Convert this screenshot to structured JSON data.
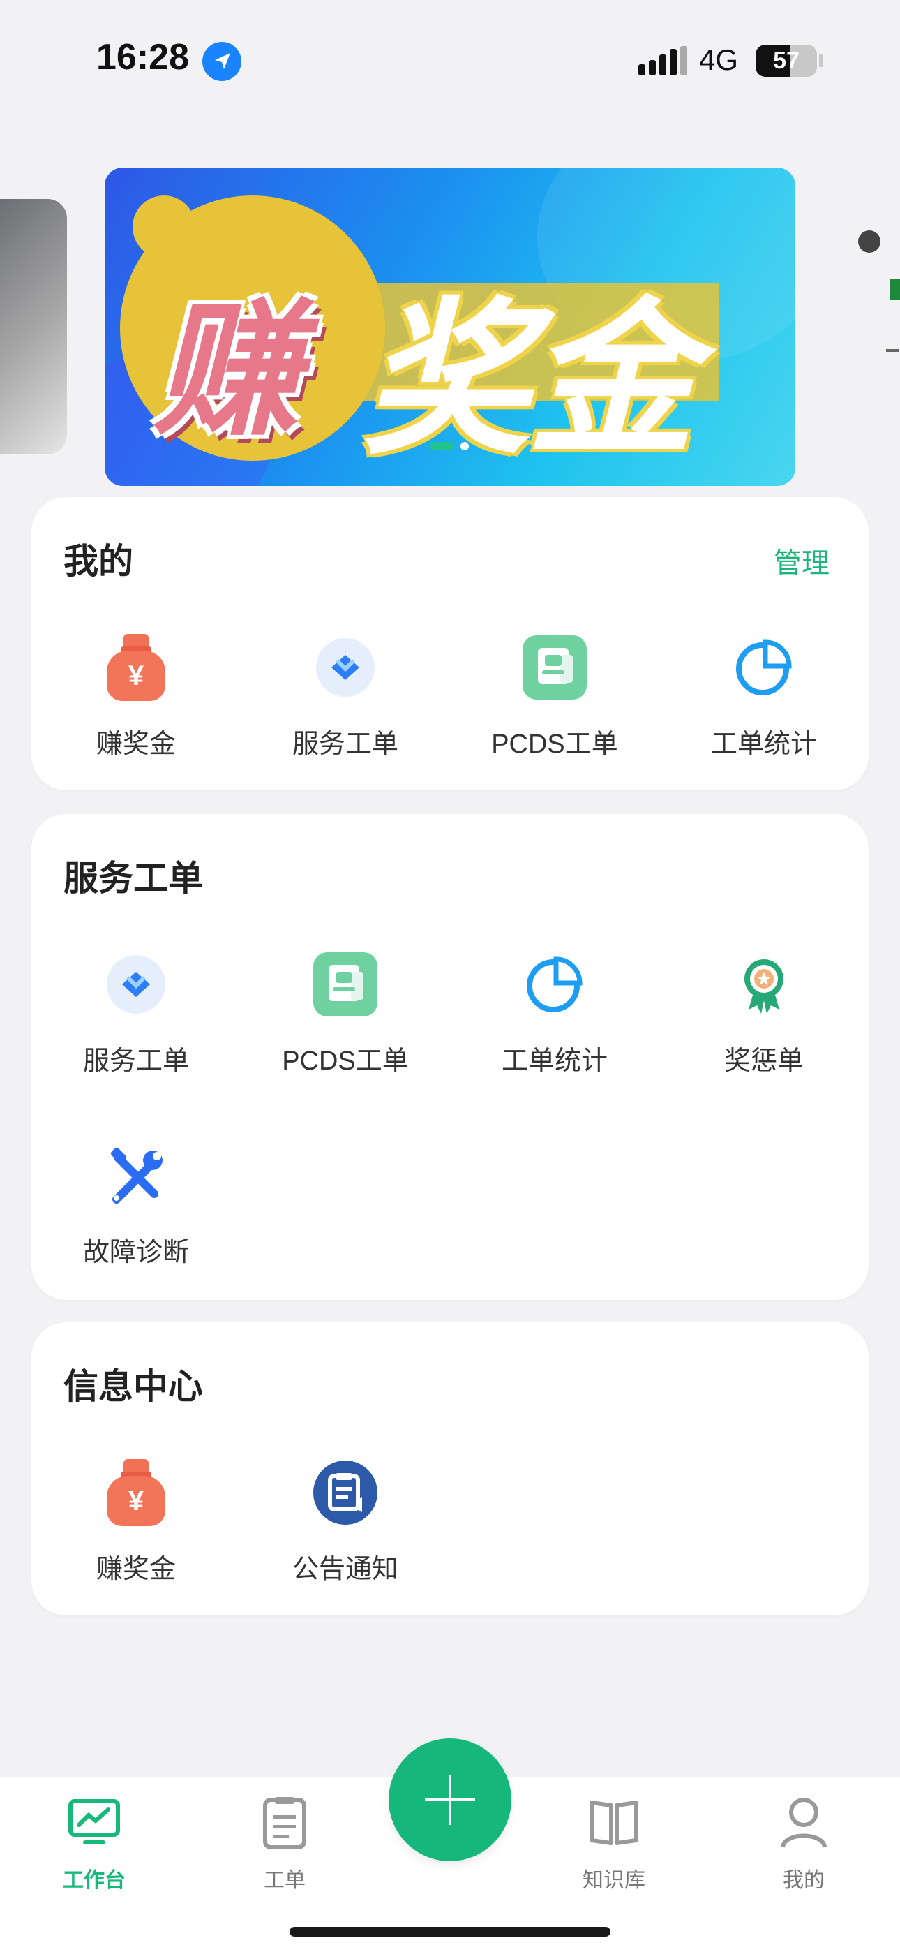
{
  "status_bar": {
    "time": "16:28",
    "network": "4G",
    "battery": "57",
    "battery_level_percent": 57
  },
  "banner": {
    "title_left": "赚",
    "title_right": "奖金",
    "active_slide_index": 0,
    "slide_count": 2
  },
  "my_section": {
    "title": "我的",
    "manage_label": "管理",
    "items": [
      {
        "label": "赚奖金",
        "icon": "money-bag-icon"
      },
      {
        "label": "服务工单",
        "icon": "service-order-icon"
      },
      {
        "label": "PCDS工单",
        "icon": "pcds-order-icon"
      },
      {
        "label": "工单统计",
        "icon": "pie-chart-icon"
      }
    ]
  },
  "service_section": {
    "title": "服务工单",
    "items": [
      {
        "label": "服务工单",
        "icon": "service-order-icon"
      },
      {
        "label": "PCDS工单",
        "icon": "pcds-order-icon"
      },
      {
        "label": "工单统计",
        "icon": "pie-chart-icon"
      },
      {
        "label": "奖惩单",
        "icon": "award-badge-icon"
      },
      {
        "label": "故障诊断",
        "icon": "tools-icon"
      }
    ]
  },
  "info_section": {
    "title": "信息中心",
    "items": [
      {
        "label": "赚奖金",
        "icon": "money-bag-icon"
      },
      {
        "label": "公告通知",
        "icon": "announcement-icon"
      }
    ]
  },
  "bottom_nav": {
    "tabs": [
      {
        "label": "工作台",
        "icon": "monitor-chart-icon",
        "active": true
      },
      {
        "label": "工单",
        "icon": "clipboard-icon",
        "active": false
      },
      {
        "label": "知识库",
        "icon": "book-icon",
        "active": false
      },
      {
        "label": "我的",
        "icon": "person-icon",
        "active": false
      }
    ],
    "fab_icon": "plus-icon"
  },
  "colors": {
    "accent": "#16b77a",
    "banner_blue": "#1b8ff0",
    "bag_orange": "#f27559"
  }
}
